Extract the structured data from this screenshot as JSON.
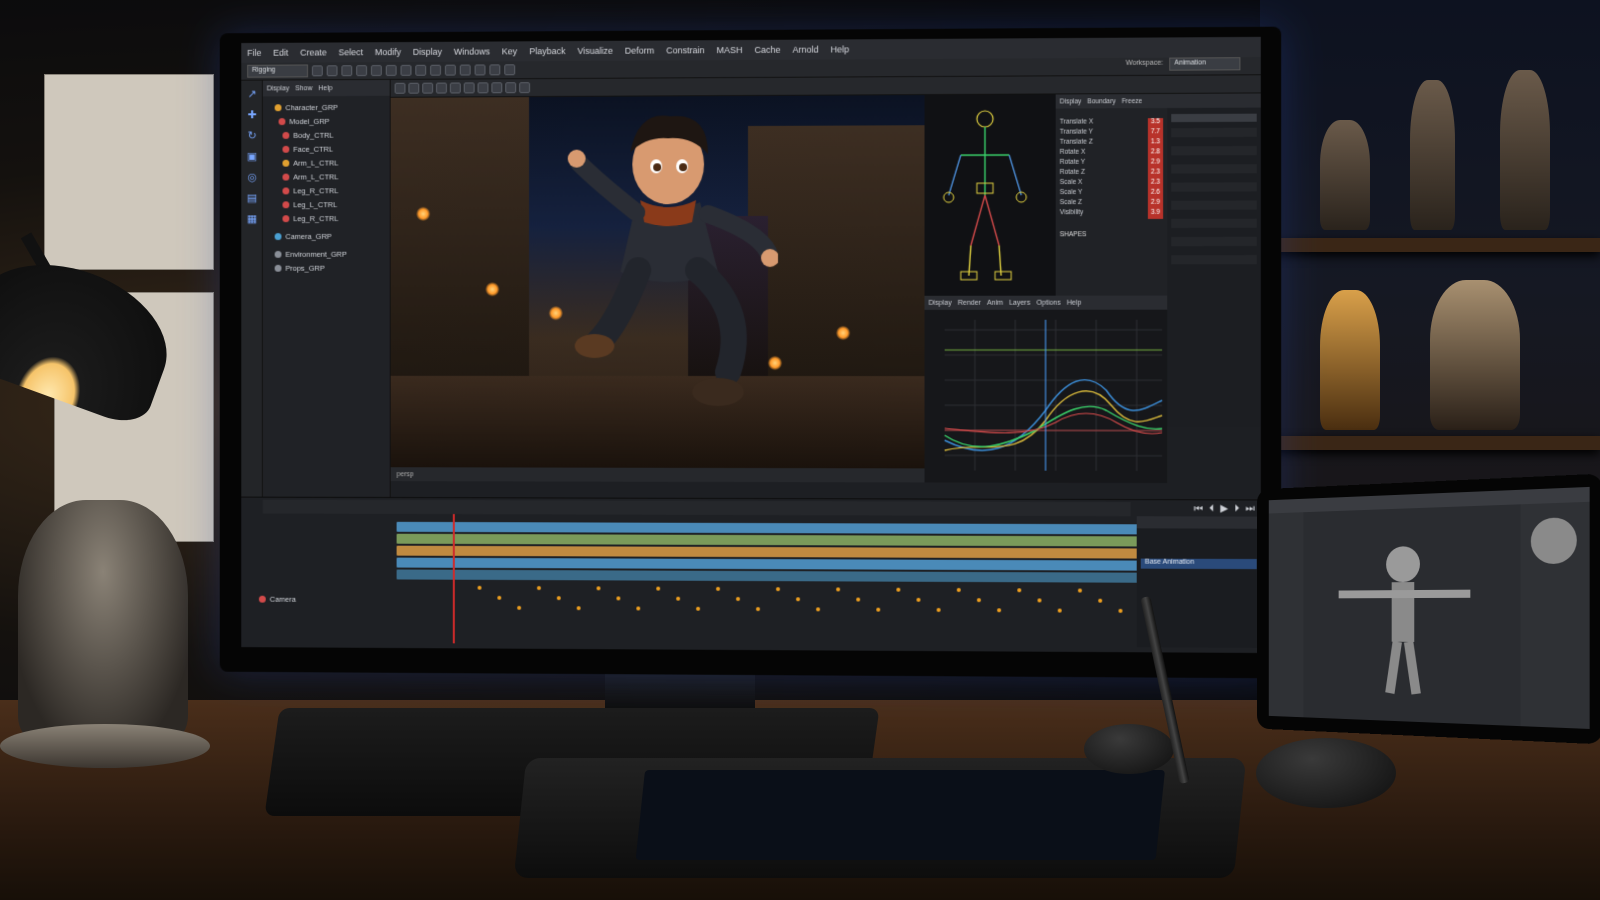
{
  "app": {
    "menu": [
      "File",
      "Edit",
      "Create",
      "Select",
      "Modify",
      "Display",
      "Windows",
      "Key",
      "Playback",
      "Visualize",
      "Deform",
      "Constrain",
      "MASH",
      "Cache",
      "Arnold",
      "Help"
    ],
    "mode_dropdown": "Rigging",
    "workspace_label": "Workspace:",
    "workspace_value": "Animation"
  },
  "outliner": {
    "tabs": [
      "Display",
      "Show",
      "Help"
    ],
    "items": [
      {
        "label": "Character_GRP",
        "color": "#e0a030"
      },
      {
        "label": "Model_GRP",
        "color": "#d24a4a"
      },
      {
        "label": "Body_CTRL",
        "color": "#d24a4a"
      },
      {
        "label": "Face_CTRL",
        "color": "#d24a4a"
      },
      {
        "label": "Arm_L_CTRL",
        "color": "#e0a030"
      },
      {
        "label": "Arm_L_CTRL",
        "color": "#d24a4a"
      },
      {
        "label": "Leg_R_CTRL",
        "color": "#d24a4a"
      },
      {
        "label": "Leg_L_CTRL",
        "color": "#d24a4a"
      },
      {
        "label": "Leg_R_CTRL",
        "color": "#d24a4a"
      },
      {
        "label": "Camera_GRP",
        "color": "#4aa0d2"
      },
      {
        "label": "Environment_GRP",
        "color": "#8a8f98"
      },
      {
        "label": "Props_GRP",
        "color": "#8a8f98"
      }
    ]
  },
  "viewport": {
    "status_left": "persp"
  },
  "attributes": {
    "tabs": [
      "Display",
      "Boundary",
      "Freeze"
    ],
    "channels": [
      {
        "name": "Translate X",
        "value": "3.5"
      },
      {
        "name": "Translate Y",
        "value": "7.7"
      },
      {
        "name": "Translate Z",
        "value": "1.3"
      },
      {
        "name": "Rotate X",
        "value": "2.8"
      },
      {
        "name": "Rotate Y",
        "value": "2.9"
      },
      {
        "name": "Rotate Z",
        "value": "2.3"
      },
      {
        "name": "Scale X",
        "value": "2.3"
      },
      {
        "name": "Scale Y",
        "value": "2.6"
      },
      {
        "name": "Scale Z",
        "value": "2.9"
      },
      {
        "name": "Visibility",
        "value": "3.9"
      }
    ],
    "shapes_label": "SHAPES"
  },
  "graph_editor": {
    "tabs": [
      "Display",
      "Render",
      "Anim",
      "Layers",
      "Options",
      "Help"
    ]
  },
  "timeline": {
    "tracks": [
      {
        "label": "",
        "color": "#4a8ab8"
      },
      {
        "label": "",
        "color": "#7a9a5a"
      },
      {
        "label": "",
        "color": "#c08a40"
      },
      {
        "label": "",
        "color": "#4a8ab8"
      },
      {
        "label": "",
        "color": "#4a8ab8"
      },
      {
        "label": "Camera",
        "color": "#d24a4a"
      }
    ],
    "layers_item": "Base Animation"
  },
  "colors": {
    "accent_blue": "#4aa0ff",
    "playhead": "#d12a2a",
    "key": "#f0a020"
  }
}
